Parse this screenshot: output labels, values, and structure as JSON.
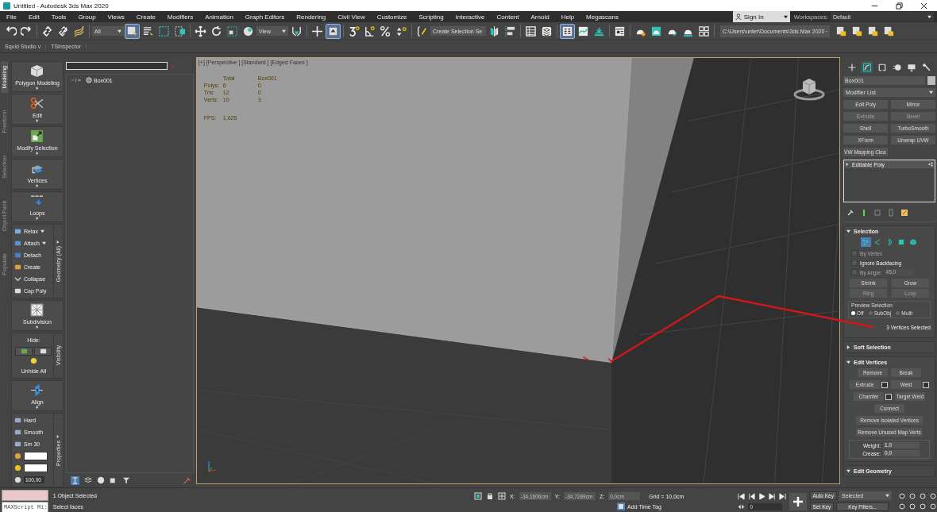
{
  "window": {
    "title": "Untitled - Autodesk 3ds Max 2020"
  },
  "menu": [
    "File",
    "Edit",
    "Tools",
    "Group",
    "Views",
    "Create",
    "Modifiers",
    "Animation",
    "Graph Editors",
    "Rendering",
    "Civil View",
    "Customize",
    "Scripting",
    "Interactive",
    "Content",
    "Arnold",
    "Help",
    "Megascans"
  ],
  "account": {
    "label": "Sign In"
  },
  "workspaces": {
    "label": "Workspaces:",
    "value": "Default"
  },
  "toolbar": [
    {
      "kind": "undo",
      "selected": false
    },
    {
      "kind": "redo",
      "selected": false
    },
    {
      "kind": "separator"
    },
    {
      "kind": "link",
      "selected": false
    },
    {
      "kind": "unlink",
      "selected": false
    },
    {
      "kind": "bind",
      "selected": false
    },
    {
      "kind": "separator"
    },
    {
      "kind": "dropdown",
      "value": "All"
    },
    {
      "kind": "select",
      "selected": true
    },
    {
      "kind": "select_list",
      "selected": false
    },
    {
      "kind": "region",
      "selected": false
    },
    {
      "kind": "crossing",
      "selected": false
    },
    {
      "kind": "separator"
    },
    {
      "kind": "move",
      "selected": false
    },
    {
      "kind": "rotate",
      "selected": false
    },
    {
      "kind": "scale",
      "selected": false
    },
    {
      "kind": "placement",
      "selected": false
    },
    {
      "kind": "dropdown",
      "value": "View"
    },
    {
      "kind": "pivot",
      "selected": false
    },
    {
      "kind": "separator"
    },
    {
      "kind": "crosshair",
      "selected": false
    },
    {
      "kind": "override",
      "selected": true
    },
    {
      "kind": "separator"
    },
    {
      "kind": "snap",
      "selected": false
    },
    {
      "kind": "angle_snap",
      "selected": false
    },
    {
      "kind": "percent_snap",
      "selected": false
    },
    {
      "kind": "spinner_snap",
      "selected": false
    },
    {
      "kind": "separator"
    },
    {
      "kind": "named_selection",
      "selected": false
    },
    {
      "kind": "dropdown",
      "value": "Create Selection Se"
    },
    {
      "kind": "mirror",
      "selected": false
    },
    {
      "kind": "align",
      "selected": false
    },
    {
      "kind": "separator"
    },
    {
      "kind": "table",
      "selected": false
    },
    {
      "kind": "layers",
      "selected": false
    },
    {
      "kind": "separator"
    },
    {
      "kind": "ribbon",
      "selected": true
    },
    {
      "kind": "curve",
      "selected": false
    },
    {
      "kind": "schematic",
      "selected": false
    },
    {
      "kind": "separator"
    },
    {
      "kind": "material",
      "selected": false
    },
    {
      "kind": "separator"
    },
    {
      "kind": "render_setup",
      "selected": false
    },
    {
      "kind": "frame_window",
      "selected": false
    },
    {
      "kind": "render",
      "selected": false
    },
    {
      "kind": "activeshade",
      "selected": false
    },
    {
      "kind": "tiles",
      "selected": false
    },
    {
      "kind": "separator"
    },
    {
      "kind": "path",
      "value": "C:\\Users\\unter\\Documents\\3ds Max 2020"
    },
    {
      "kind": "project",
      "selected": false
    },
    {
      "kind": "project",
      "selected": false
    },
    {
      "kind": "project",
      "selected": false
    },
    {
      "kind": "project",
      "selected": false
    }
  ],
  "ribbon_tabs": [
    "Squid Studio v",
    "TSInspector"
  ],
  "side_tabs": [
    {
      "label": "Modeling",
      "selected": true
    },
    {
      "label": "Freeform",
      "selected": false
    },
    {
      "label": "Selection",
      "selected": false
    },
    {
      "label": "Object Paint",
      "selected": false
    },
    {
      "label": "Populate",
      "selected": false
    }
  ],
  "ribbon": [
    {
      "kind": "large",
      "label": "Polygon Modeling"
    },
    {
      "kind": "large",
      "label": "Edit"
    },
    {
      "kind": "large",
      "label": "Modify Selection"
    },
    {
      "kind": "large",
      "label": "Vertices"
    },
    {
      "kind": "large",
      "label": "Loops"
    },
    {
      "kind": "group",
      "title": "Geometry (All)",
      "items": [
        {
          "label": "Relax",
          "menu": true
        },
        {
          "label": "Attach",
          "menu": true
        },
        {
          "label": "Detach",
          "menu": false
        },
        {
          "label": "Create",
          "menu": false
        },
        {
          "label": "Collapse",
          "menu": false
        },
        {
          "label": "Cap Poly",
          "menu": false
        }
      ]
    },
    {
      "kind": "large",
      "label": "Subdivision"
    },
    {
      "kind": "visibility",
      "title": "Visibility",
      "hide": "Hide:",
      "unhide": "Unhide All"
    },
    {
      "kind": "large",
      "label": "Align"
    },
    {
      "kind": "properties",
      "title": "Properties",
      "items": [
        "Hard",
        "Smooth",
        "Sm 30"
      ],
      "opacity": "100,00"
    }
  ],
  "scene_explorer": {
    "items": [
      {
        "name": "Box001"
      }
    ]
  },
  "viewport": {
    "labels": [
      "[+]",
      "[Perspective ]",
      "[Standard ]",
      "[Edged Faces ]"
    ],
    "stats_header": [
      "Total",
      "Box001"
    ],
    "stats": [
      {
        "label": "Polys:",
        "total": "6",
        "selection": "0"
      },
      {
        "label": "Tris:",
        "total": "12",
        "selection": "0"
      },
      {
        "label": "Verts:",
        "total": "10",
        "selection": "3"
      }
    ],
    "fps": {
      "label": "FPS:",
      "value": "1,625"
    }
  },
  "command_panel": {
    "tabs": [
      {
        "kind": "create",
        "selected": false
      },
      {
        "kind": "modify",
        "selected": true
      },
      {
        "kind": "hierarchy",
        "selected": false
      },
      {
        "kind": "motion",
        "selected": false
      },
      {
        "kind": "display",
        "selected": false
      },
      {
        "kind": "utilities",
        "selected": false
      }
    ],
    "object_name": "Box001",
    "modifier_list": "Modifier List",
    "modifier_buttons": [
      {
        "label": "Edit Poly",
        "disabled": false
      },
      {
        "label": "Mirror",
        "disabled": false
      },
      {
        "label": "Extrude",
        "disabled": true
      },
      {
        "label": "Bevel",
        "disabled": true
      },
      {
        "label": "Shell",
        "disabled": false
      },
      {
        "label": "TurboSmooth",
        "disabled": false
      },
      {
        "label": "XForm",
        "disabled": false
      },
      {
        "label": "Unwrap UVW",
        "disabled": false
      },
      {
        "label": "VW Mapping Clea",
        "disabled": false
      }
    ],
    "stack": [
      {
        "label": "Editable Poly"
      }
    ],
    "rollouts": [
      {
        "kind": "selection",
        "title": "Selection",
        "expanded": true,
        "subobjects": [
          {
            "kind": "vertex",
            "selected": true
          },
          {
            "kind": "edge",
            "selected": false
          },
          {
            "kind": "border",
            "selected": false
          },
          {
            "kind": "polygon",
            "selected": false
          },
          {
            "kind": "element",
            "selected": false
          }
        ],
        "options": [
          {
            "label": "By Vertex",
            "checked": false,
            "disabled": true
          },
          {
            "label": "Ignore Backfacing",
            "checked": false,
            "disabled": false
          },
          {
            "label": "By Angle:",
            "checked": false,
            "disabled": true,
            "value": "45,0"
          }
        ],
        "buttons": [
          {
            "label": "Shrink",
            "disabled": false
          },
          {
            "label": "Grow",
            "disabled": false
          },
          {
            "label": "Ring",
            "disabled": true
          },
          {
            "label": "Loop",
            "disabled": true
          }
        ],
        "preview": {
          "title": "Preview Selection",
          "options": [
            {
              "label": "Off",
              "selected": true
            },
            {
              "label": "SubObj",
              "selected": false
            },
            {
              "label": "Multi",
              "selected": false
            }
          ]
        },
        "status": "3 Vertices Selected"
      },
      {
        "kind": "plain",
        "title": "Soft Selection",
        "expanded": false
      },
      {
        "kind": "edit_vertices",
        "title": "Edit Vertices",
        "expanded": true,
        "rows": [
          [
            {
              "label": "Remove",
              "settings": false
            },
            {
              "label": "Break",
              "settings": false
            }
          ],
          [
            {
              "label": "Extrude",
              "settings": true
            },
            {
              "label": "Weld",
              "settings": true
            }
          ],
          [
            {
              "label": "Chamfer",
              "settings": true
            },
            {
              "label": "Target Weld",
              "settings": false
            }
          ],
          [
            {
              "label": "Connect",
              "settings": false
            }
          ],
          [
            {
              "label": "Remove Isolated Vertices",
              "settings": false
            }
          ],
          [
            {
              "label": "Remove Unused Map Verts",
              "settings": false
            }
          ]
        ],
        "fields": [
          {
            "label": "Weight:",
            "value": "1,0"
          },
          {
            "label": "Crease:",
            "value": "0,0"
          }
        ]
      },
      {
        "kind": "plain",
        "title": "Edit Geometry",
        "expanded": true
      }
    ]
  },
  "status_bar": {
    "listener": "MAXScript Mi:",
    "prompt": "1 Object Selected",
    "hint": "Select faces",
    "coords": [
      {
        "label": "X:",
        "value": "-34,1606cm"
      },
      {
        "label": "Y:",
        "value": "-34,7289cm"
      },
      {
        "label": "Z:",
        "value": "0,0cm"
      }
    ],
    "grid": "Grid = 10,0cm",
    "time_tag": "Add Time Tag",
    "auto_key": "Auto Key",
    "key_mode": "Selected",
    "set_key": "Set Key",
    "key_filters": "Key Filters...",
    "frame": "0"
  }
}
